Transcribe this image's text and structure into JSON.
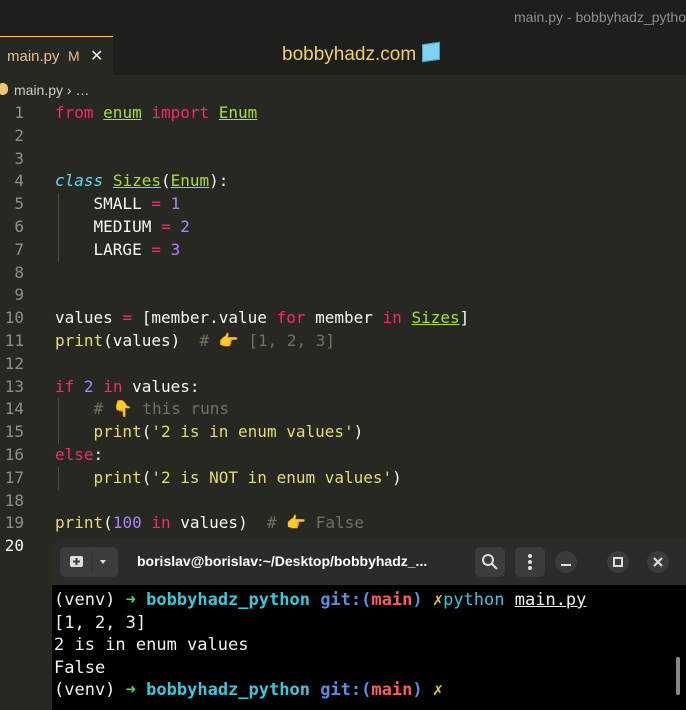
{
  "window": {
    "title": "main.py - bobbyhadz_pytho"
  },
  "tab": {
    "filename": "main.py",
    "modified_marker": "M",
    "close": "✕"
  },
  "site_label": "bobbyhadz.com",
  "breadcrumb": {
    "file": "main.py",
    "separator": "› …"
  },
  "editor": {
    "line_numbers": [
      "1",
      "2",
      "3",
      "4",
      "5",
      "6",
      "7",
      "8",
      "9",
      "10",
      "11",
      "12",
      "13",
      "14",
      "15",
      "16",
      "17",
      "18",
      "19",
      "20"
    ],
    "tokens": {
      "l1": [
        "from",
        "enum",
        "import",
        "Enum"
      ],
      "l4": [
        "class",
        "Sizes",
        "(",
        "Enum",
        "):"
      ],
      "l5": [
        "SMALL",
        "=",
        "1"
      ],
      "l6": [
        "MEDIUM",
        "=",
        "2"
      ],
      "l7": [
        "LARGE",
        "=",
        "3"
      ],
      "l10": [
        "values",
        "=",
        "[member.value",
        "for",
        "member",
        "in",
        "Sizes",
        "]"
      ],
      "l11": [
        "print",
        "(values)",
        "# 👉 [1, 2, 3]"
      ],
      "l13": [
        "if",
        "2",
        "in",
        "values:"
      ],
      "l14": [
        "# 👇 this runs"
      ],
      "l15": [
        "print",
        "(",
        "'2 is in enum values'",
        ")"
      ],
      "l16": [
        "else",
        ":"
      ],
      "l17": [
        "print",
        "(",
        "'2 is NOT in enum values'",
        ")"
      ],
      "l19": [
        "print",
        "(",
        "100",
        "in",
        "values)",
        "# 👉 False"
      ]
    }
  },
  "terminal": {
    "title": "borislav@borislav:~/Desktop/bobbyhadz_...",
    "prompt": {
      "venv": "(venv)",
      "arrow": "➜",
      "dir": "bobbyhadz_python",
      "git": "git:(",
      "branch": "main",
      "git_close": ")",
      "dirty": "✗"
    },
    "command": [
      "python",
      "main.py"
    ],
    "output": [
      "[1, 2, 3]",
      "2 is in enum values",
      "False"
    ]
  }
}
